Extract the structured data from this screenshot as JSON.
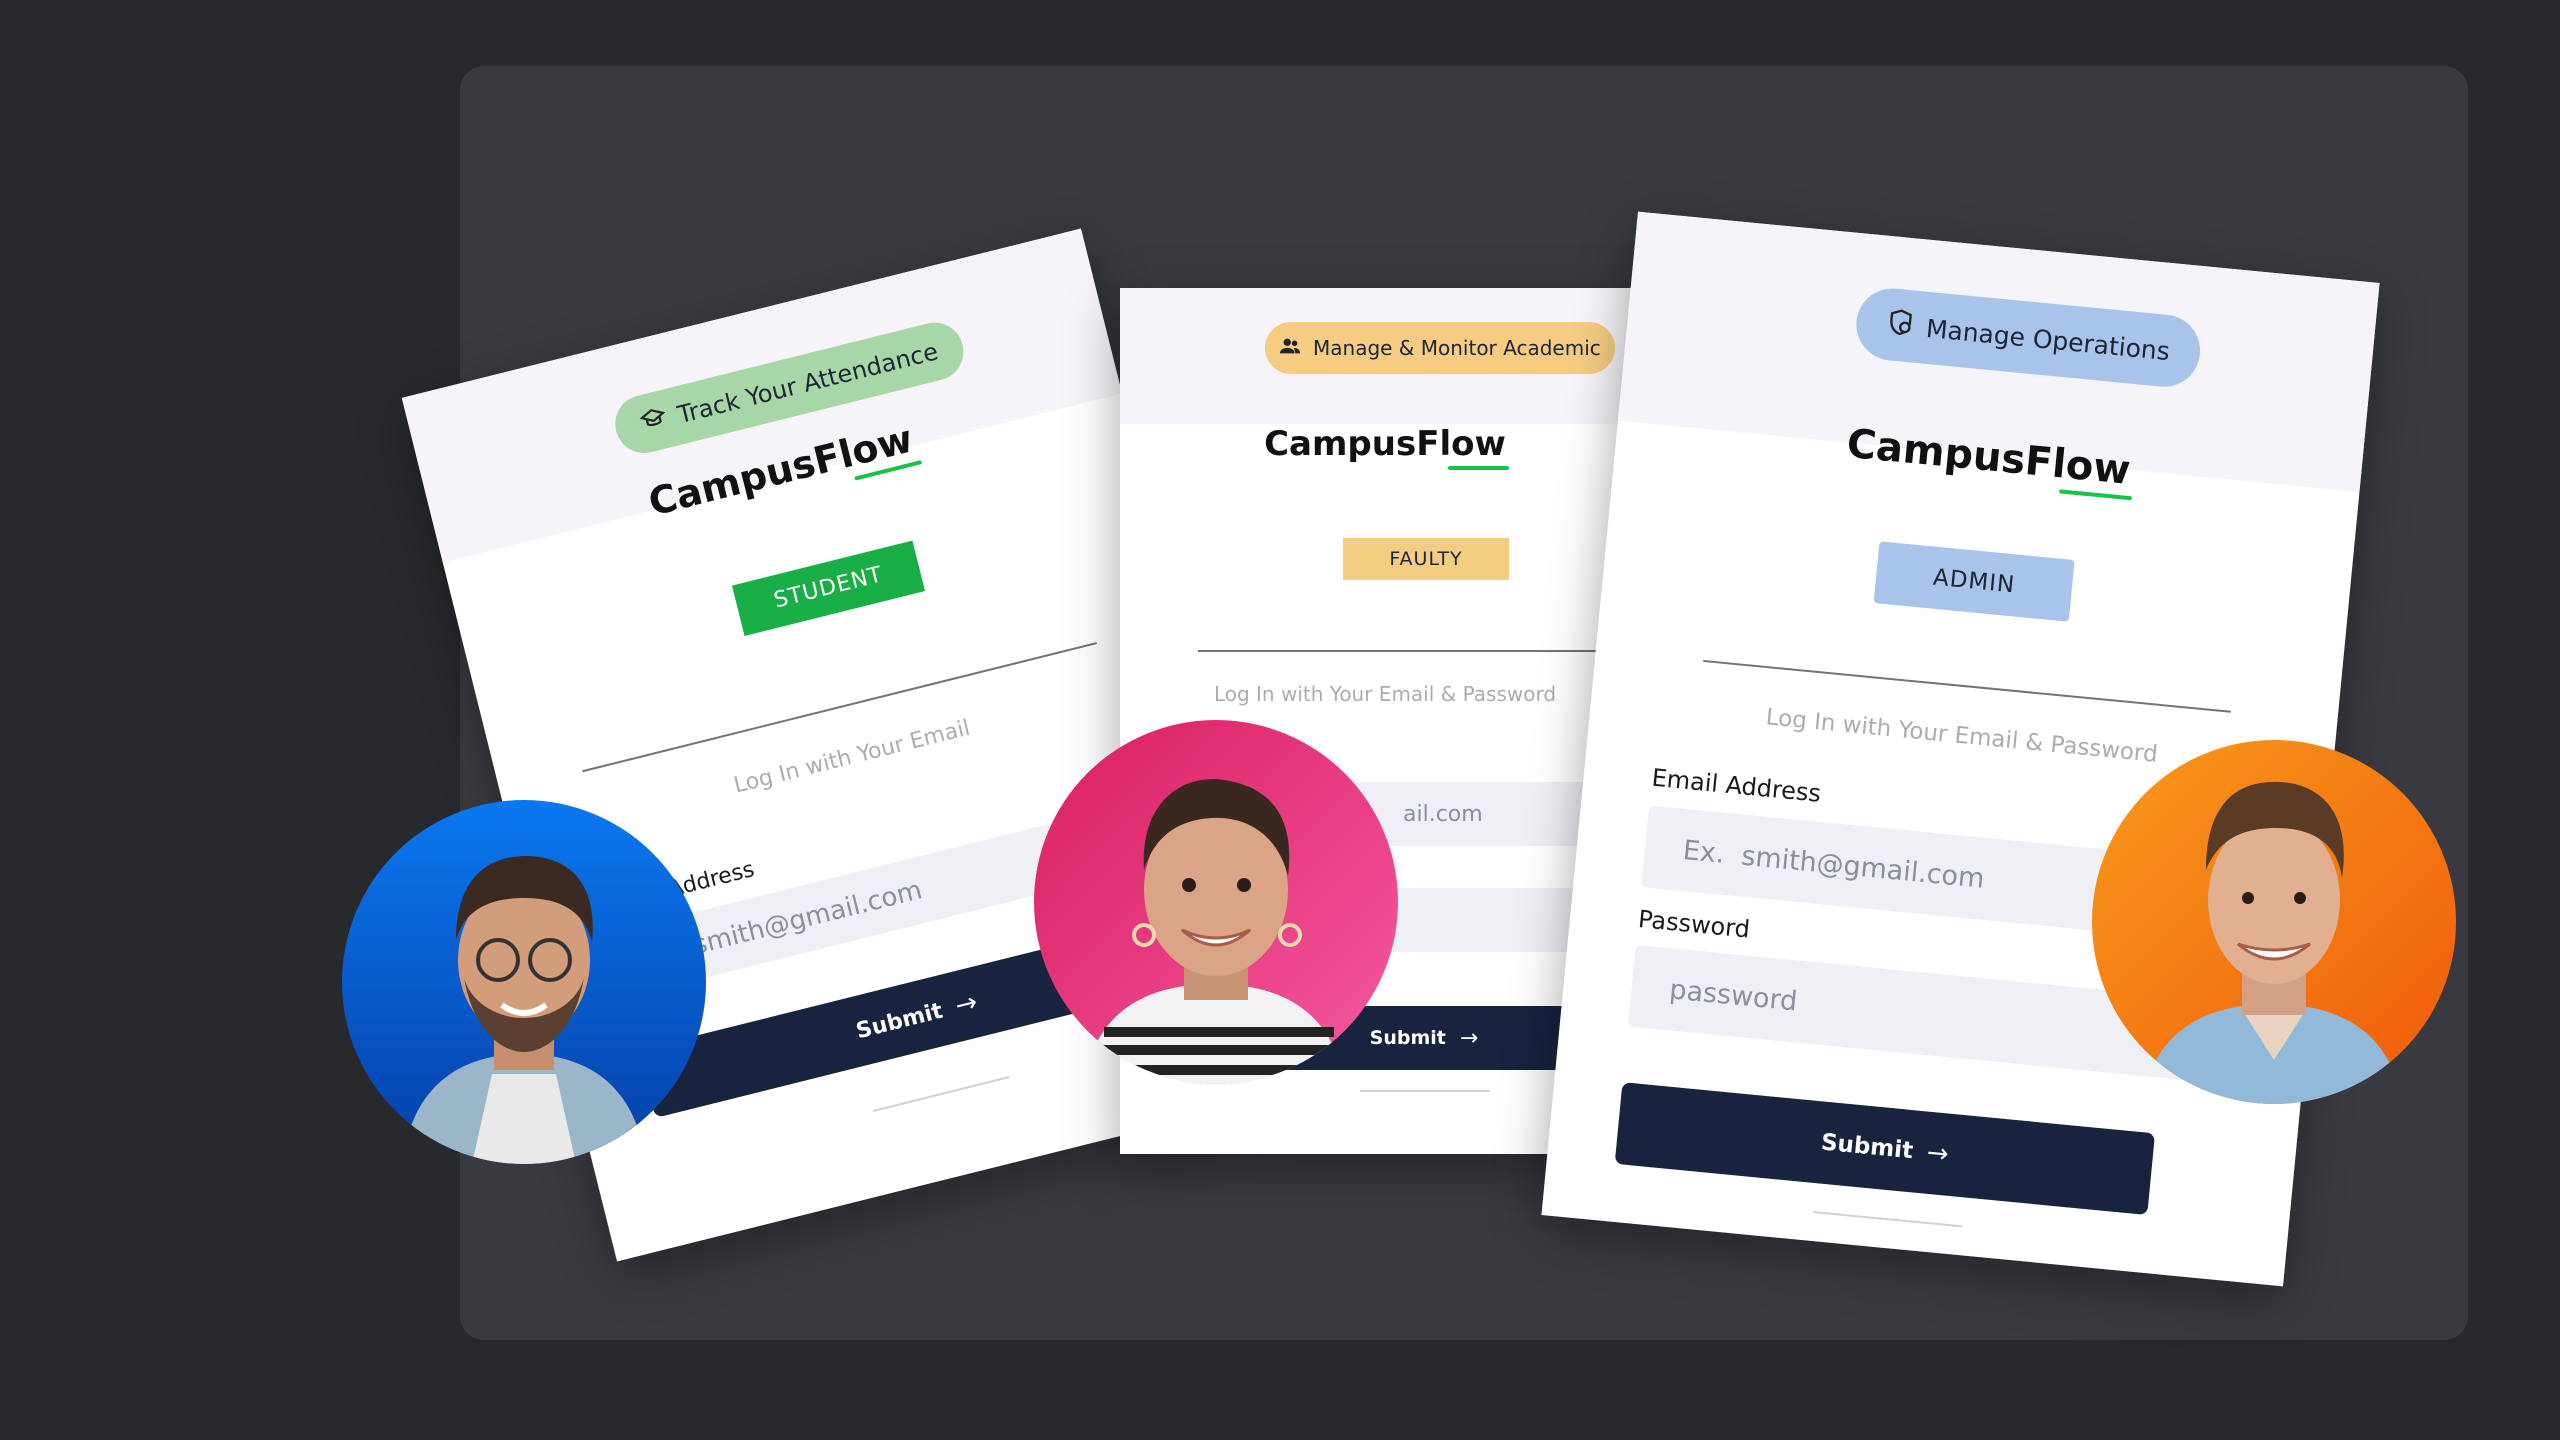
{
  "brand": "CampusFlow",
  "brand_prefix": "CampusFl",
  "brand_suffix": "ow",
  "colors": {
    "page_bg": "#27292d",
    "panel_bg": "#393a40",
    "student_pill": "#a7d7a9",
    "student_badge": "#1aae47",
    "faculty_pill": "#f5cc82",
    "faculty_badge": "#f2cd82",
    "admin_pill": "#a9c4ea",
    "admin_badge": "#a9c4ea",
    "submit_bg": "#17233f",
    "accent_green": "#19c24a"
  },
  "cards": {
    "student": {
      "pill_label": "Track Your Attendance",
      "pill_icon": "graduation-cap-icon",
      "role_badge": "STUDENT",
      "hint": "Log In with Your Email",
      "email_label": "Email Address",
      "email_placeholder": "Ex.  smith@gmail.com",
      "submit_label": "Submit"
    },
    "faculty": {
      "pill_label": "Manage & Monitor Academic",
      "pill_icon": "users-icon",
      "role_badge": "FAULTY",
      "hint": "Log In with Your Email & Password",
      "email_placeholder_visible": "ail.com",
      "submit_label": "Submit"
    },
    "admin": {
      "pill_label": "Manage Operations",
      "pill_icon": "shield-gear-icon",
      "role_badge": "ADMIN",
      "hint": "Log In with Your Email & Password",
      "email_label": "Email Address",
      "email_placeholder": "Ex.  smith@gmail.com",
      "password_label": "Password",
      "password_placeholder": "password",
      "submit_label": "Submit"
    }
  },
  "avatars": [
    {
      "name": "man-with-glasses",
      "bg": "#0a5fd6"
    },
    {
      "name": "smiling-woman",
      "bg": "#ec3f86"
    },
    {
      "name": "smiling-man",
      "bg": "#f47b12"
    }
  ]
}
